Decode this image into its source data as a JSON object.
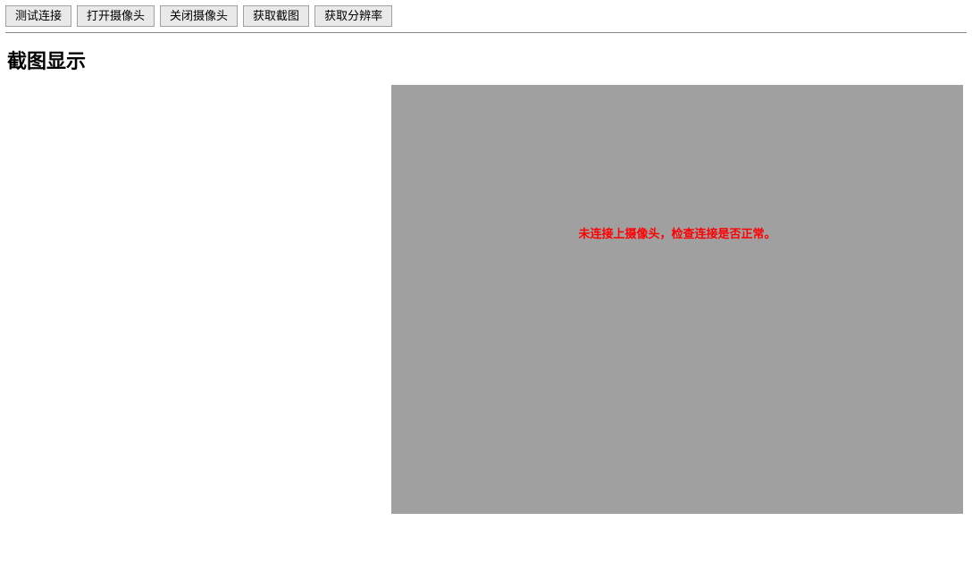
{
  "toolbar": {
    "test_connection": "测试连接",
    "open_camera": "打开摄像头",
    "close_camera": "关闭摄像头",
    "get_screenshot": "获取截图",
    "get_resolution": "获取分辨率"
  },
  "section": {
    "title": "截图显示"
  },
  "camera": {
    "error_message": "未连接上摄像头，检查连接是否正常。"
  }
}
